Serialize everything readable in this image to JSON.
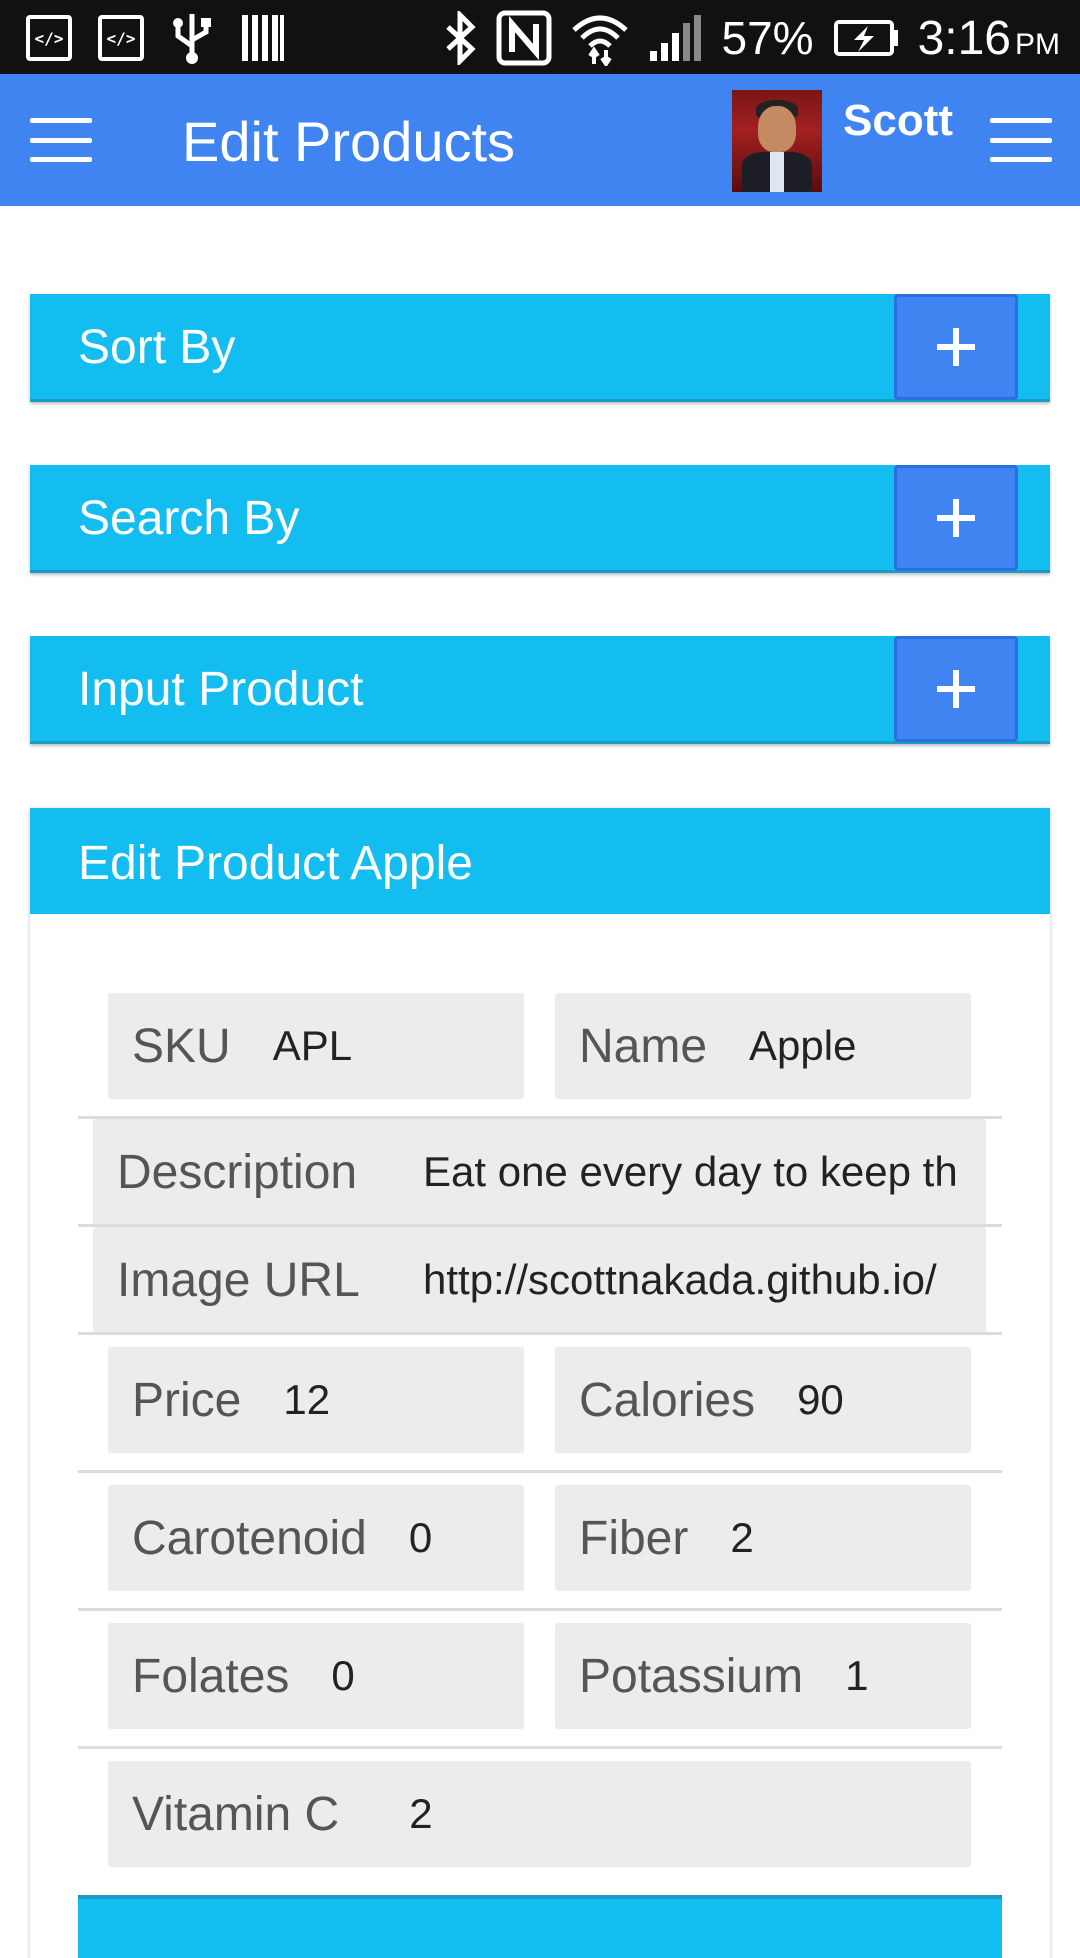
{
  "status_bar": {
    "left_icons": [
      "code-icon",
      "code-icon",
      "usb-icon",
      "barcode-icon"
    ],
    "right_icons": [
      "bluetooth-icon",
      "nfc-icon",
      "wifi-icon",
      "signal-icon"
    ],
    "battery_percent": "57%",
    "time": "3:16",
    "ampm": "PM"
  },
  "app_bar": {
    "title": "Edit Products",
    "user_name": "Scott"
  },
  "panels": [
    {
      "label": "Sort By",
      "toggle": "+"
    },
    {
      "label": "Search By",
      "toggle": "+"
    },
    {
      "label": "Input Product",
      "toggle": "+"
    }
  ],
  "edit_product": {
    "title": "Edit Product Apple",
    "fields": {
      "sku": {
        "label": "SKU",
        "value": "APL"
      },
      "name": {
        "label": "Name",
        "value": "Apple"
      },
      "description": {
        "label": "Description",
        "value": "Eat one every day to keep the doctor away"
      },
      "image_url": {
        "label": "Image URL",
        "value": "http://scottnakada.github.io/"
      },
      "price": {
        "label": "Price",
        "value": "12"
      },
      "calories": {
        "label": "Calories",
        "value": "90"
      },
      "carotenoid": {
        "label": "Carotenoid",
        "value": "0"
      },
      "fiber": {
        "label": "Fiber",
        "value": "2"
      },
      "folates": {
        "label": "Folates",
        "value": "0"
      },
      "potassium": {
        "label": "Potassium",
        "value": "1"
      },
      "vitamin_c": {
        "label": "Vitamin C",
        "value": "2"
      }
    }
  }
}
